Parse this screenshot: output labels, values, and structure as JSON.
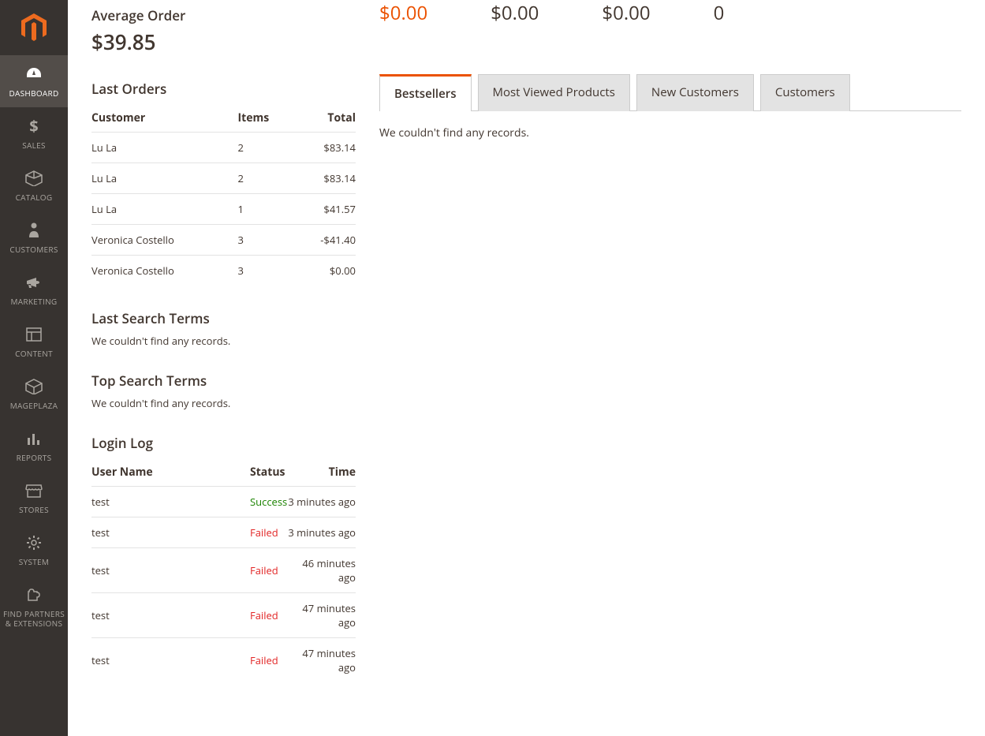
{
  "sidebar": {
    "items": [
      {
        "label": "DASHBOARD",
        "icon": "dashboard"
      },
      {
        "label": "SALES",
        "icon": "dollar"
      },
      {
        "label": "CATALOG",
        "icon": "box"
      },
      {
        "label": "CUSTOMERS",
        "icon": "person"
      },
      {
        "label": "MARKETING",
        "icon": "megaphone"
      },
      {
        "label": "CONTENT",
        "icon": "layout"
      },
      {
        "label": "MAGEPLAZA",
        "icon": "cube"
      },
      {
        "label": "REPORTS",
        "icon": "bars"
      },
      {
        "label": "STORES",
        "icon": "storefront"
      },
      {
        "label": "SYSTEM",
        "icon": "gear"
      },
      {
        "label": "FIND PARTNERS & EXTENSIONS",
        "icon": "puzzle"
      }
    ]
  },
  "avg_order": {
    "label": "Average Order",
    "value": "$39.85"
  },
  "last_orders": {
    "title": "Last Orders",
    "cols": [
      "Customer",
      "Items",
      "Total"
    ],
    "rows": [
      {
        "customer": "Lu La",
        "items": "2",
        "total": "$83.14"
      },
      {
        "customer": "Lu La",
        "items": "2",
        "total": "$83.14"
      },
      {
        "customer": "Lu La",
        "items": "1",
        "total": "$41.57"
      },
      {
        "customer": "Veronica Costello",
        "items": "3",
        "total": "-$41.40"
      },
      {
        "customer": "Veronica Costello",
        "items": "3",
        "total": "$0.00"
      }
    ]
  },
  "last_search": {
    "title": "Last Search Terms",
    "msg": "We couldn't find any records."
  },
  "top_search": {
    "title": "Top Search Terms",
    "msg": "We couldn't find any records."
  },
  "login_log": {
    "title": "Login Log",
    "cols": [
      "User Name",
      "Status",
      "Time"
    ],
    "rows": [
      {
        "user": "test",
        "status": "Success",
        "time": "3 minutes ago"
      },
      {
        "user": "test",
        "status": "Failed",
        "time": "3 minutes ago"
      },
      {
        "user": "test",
        "status": "Failed",
        "time": "46 minutes ago"
      },
      {
        "user": "test",
        "status": "Failed",
        "time": "47 minutes ago"
      },
      {
        "user": "test",
        "status": "Failed",
        "time": "47 minutes ago"
      }
    ]
  },
  "stats": [
    "$0.00",
    "$0.00",
    "$0.00",
    "0"
  ],
  "tabs": {
    "items": [
      "Bestsellers",
      "Most Viewed Products",
      "New Customers",
      "Customers"
    ],
    "content": "We couldn't find any records."
  }
}
